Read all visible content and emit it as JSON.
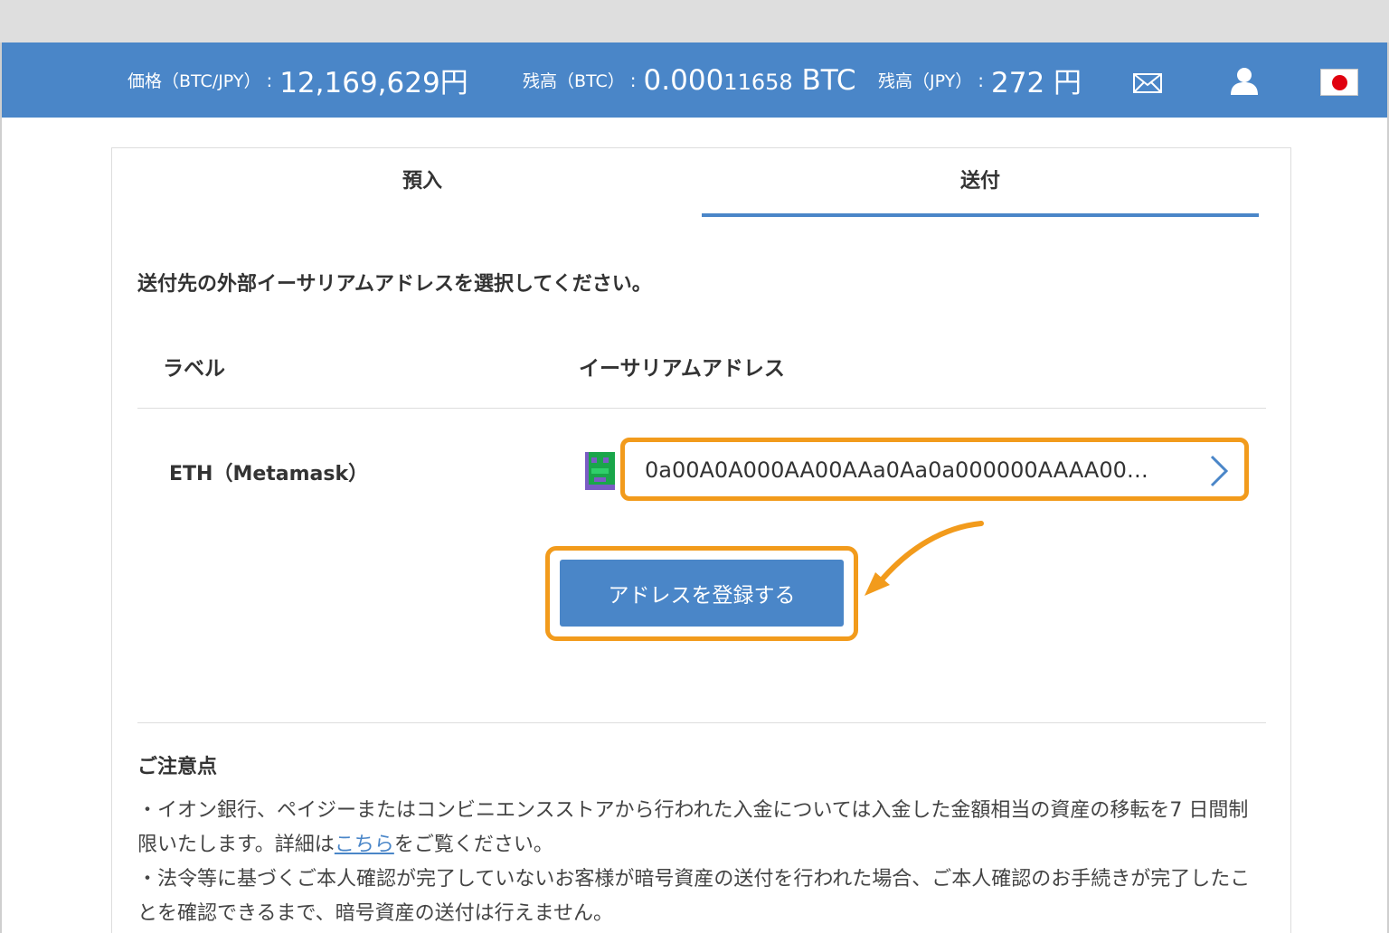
{
  "header": {
    "price_label": "価格（BTC/JPY）",
    "price_value": "12,169,629円",
    "btc_balance_label": "残高（BTC）",
    "btc_balance_value_main": "0.000",
    "btc_balance_value_small": "11658",
    "btc_balance_unit": "BTC",
    "jpy_balance_label": "残高（JPY）",
    "jpy_balance_value": "272 円",
    "colon": ":",
    "icons": [
      "mail-icon",
      "user-icon",
      "japan-flag-icon"
    ]
  },
  "tabs": [
    {
      "label": "預入",
      "active": false
    },
    {
      "label": "送付",
      "active": true
    }
  ],
  "instruction": "送付先の外部イーサリアムアドレスを選択してください。",
  "table": {
    "columns": [
      "ラベル",
      "イーサリアムアドレス"
    ],
    "rows": [
      {
        "label": "ETH（Metamask）",
        "address": "0a00A0A000AA00AAa0Aa0a000000AAAA00…"
      }
    ]
  },
  "register_button_label": "アドレスを登録する",
  "notes": {
    "title": "ご注意点",
    "line1_before": "・イオン銀行、ペイジーまたはコンビニエンスストアから行われた入金については入金した金額相当の資産の移転を7 日間制限いたします。詳細は",
    "line1_link": "こちら",
    "line1_after": "をご覧ください。",
    "line2": "・法令等に基づくご本人確認が完了していないお客様が暗号資産の送付を行われた場合、ご本人確認のお手続きが完了したことを確認できるまで、暗号資産の送付は行えません。"
  },
  "colors": {
    "accent_blue": "#4a86c8",
    "highlight_orange": "#f29b1c"
  }
}
